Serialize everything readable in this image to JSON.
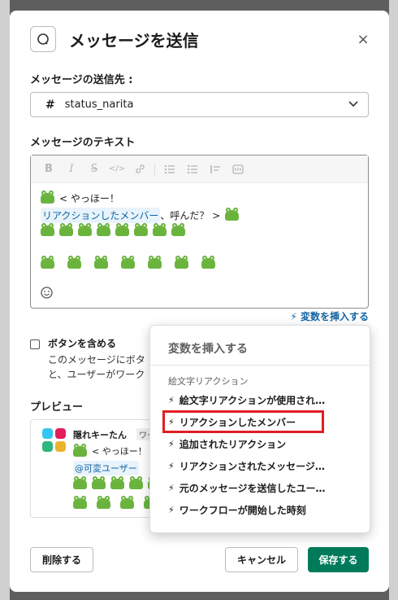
{
  "modal": {
    "title": "メッセージを送信",
    "close_label": "×"
  },
  "send_to": {
    "label": "メッセージの送信先 :",
    "channel": "status_narita"
  },
  "message_text": {
    "label": "メッセージのテキスト",
    "line1_text": "< やっほー！",
    "chip_text": "リアクションしたメンバー",
    "line2_suffix": "、呼んだ？ >",
    "insert_variable_link": "変数を挿入する"
  },
  "toolbar": {
    "bold": "B",
    "italic": "I",
    "strike": "S",
    "code": "</>",
    "link": "🔗"
  },
  "button_option": {
    "label": "ボタンを含める",
    "desc_line1": "このメッセージにボタ",
    "desc_line2": "と、ユーザーがワーク"
  },
  "preview": {
    "label": "プレビュー",
    "bot_name": "隠れキーたん",
    "badge": "ワー",
    "line1": "< やっほー！",
    "mention": "@可変ユーザー",
    "logo_colors": [
      "#36c5f0",
      "#e01e5a",
      "#2eb67d",
      "#ecb22e"
    ]
  },
  "variable_menu": {
    "title": "変数を挿入する",
    "section": "絵文字リアクション",
    "items": [
      "絵文字リアクションが使用され…",
      "リアクションしたメンバー",
      "追加されたリアクション",
      "リアクションされたメッセージ…",
      "元のメッセージを送信したユー…",
      "ワークフローが開始した時刻"
    ]
  },
  "footer": {
    "delete": "削除する",
    "cancel": "キャンセル",
    "save": "保存する"
  }
}
